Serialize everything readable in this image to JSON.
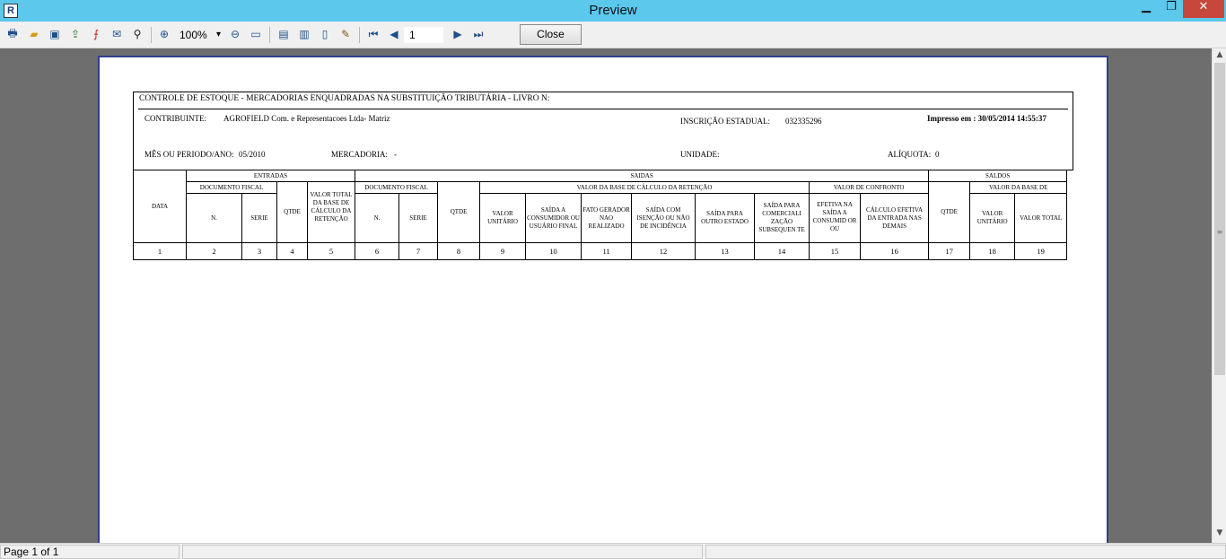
{
  "window": {
    "title": "Preview",
    "app_icon": "R"
  },
  "toolbar": {
    "zoom": "100%",
    "page": "1",
    "close_label": "Close"
  },
  "report": {
    "title": "CONTROLE DE ESTOQUE - MERCADORIAS ENQUADRADAS NA SUBSTITUIÇÃO TRIBUTÁRIA - LIVRO N:",
    "contribuinte_label": "CONTRIBUINTE:",
    "contribuinte_value": "AGROFIELD Com. e Representacoes Ltda- Matriz",
    "inscricao_label": "INSCRIÇÃO ESTADUAL:",
    "inscricao_value": "032335296",
    "impresso": "Impresso em : 30/05/2014 14:55:37",
    "mes_label": "MÊS OU PERIODO/ANO:",
    "mes_value": "05/2010",
    "mercadoria_label": "MERCADORIA:",
    "mercadoria_value": "-",
    "unidade_label": "UNIDADE:",
    "aliquota_label": "ALÍQUOTA:",
    "aliquota_value": "0"
  },
  "table": {
    "data": "DATA",
    "entradas": "ENTRADAS",
    "saidas": "SAIDAS",
    "saldos": "SALDOS",
    "doc_fiscal": "DOCUMENTO FISCAL",
    "n": "N.",
    "serie": "SERIE",
    "qtde": "QTDE",
    "valor_total_base": "VALOR TOTAL DA BASE DE CÁLCULO DA RETENÇÃO",
    "valor_base_ret": "VALOR DA BASE DE CÁLCULO DA RETENÇÃO",
    "valor_confronto": "VALOR DE CONFRONTO",
    "valor_base_de": "VALOR DA BASE DE",
    "valor_unitario": "VALOR UNITÁRIO",
    "saida_consumidor": "SAÍDA A CONSUMIDOR OU USUÁRIO FINAL",
    "fato_gerador": "FATO GERADOR NAO REALIZADO",
    "saida_isencao": "SAÍDA COM ISENÇÃO OU NÃO DE INCIDÊNCIA",
    "saida_outro_estado": "SAÍDA PARA OUTRO ESTADO",
    "saida_comercializacao": "SAÍDA PARA COMERCIALI ZAÇÃO SUBSEQUEN TE",
    "efetiva_saida": "EFETIVA NA SAÍDA A CONSUMID OR OU",
    "calculo_efetiva": "CÁLCULO EFETIVA DA ENTRADA NAS DEMAIS",
    "valor_unitario_2": "VALOR UNITÁRIO",
    "valor_total": "VALOR TOTAL",
    "numbers": [
      "1",
      "2",
      "3",
      "4",
      "5",
      "6",
      "7",
      "8",
      "9",
      "10",
      "11",
      "12",
      "13",
      "14",
      "15",
      "16",
      "17",
      "18",
      "19"
    ]
  },
  "status": {
    "page_info": "Page 1 of 1"
  }
}
